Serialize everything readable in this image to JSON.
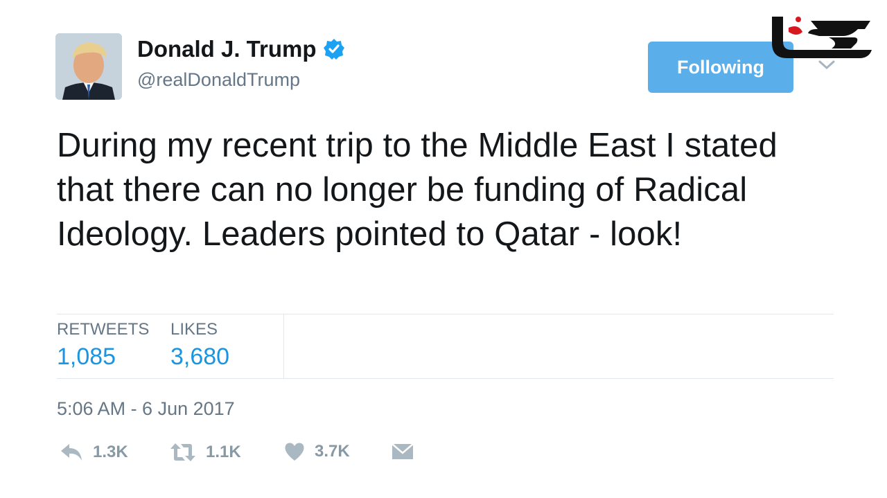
{
  "author": {
    "name": "Donald J. Trump",
    "handle": "@realDonaldTrump",
    "verified_icon": "verified-badge-icon"
  },
  "follow_button": {
    "label": "Following"
  },
  "tweet": {
    "text": "During my recent trip to the Middle East I stated that there can no longer be funding of Radical Ideology. Leaders pointed to Qatar - look!"
  },
  "stats": {
    "retweets_label": "RETWEETS",
    "retweets_value": "1,085",
    "likes_label": "LIKES",
    "likes_value": "3,680"
  },
  "timestamp": "5:06 AM - 6 Jun 2017",
  "actions": {
    "reply_count": "1.3K",
    "retweet_count": "1.1K",
    "like_count": "3.7K"
  },
  "colors": {
    "accent": "#1b95e0",
    "button": "#5aaeea",
    "muted": "#657786",
    "logo_red": "#d7191f"
  }
}
